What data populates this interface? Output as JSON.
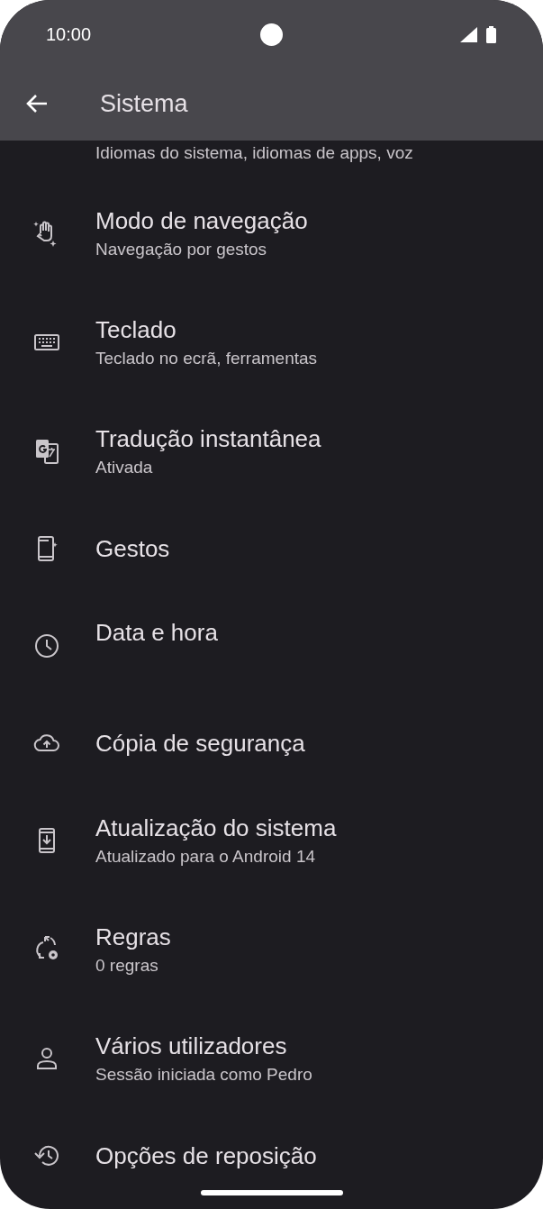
{
  "status_bar": {
    "time": "10:00"
  },
  "app_bar": {
    "title": "Sistema"
  },
  "cut_summary": "Idiomas do sistema, idiomas de apps, voz",
  "items": [
    {
      "kind": "summary",
      "title": "Modo de navegação",
      "summary": "Navegação por gestos"
    },
    {
      "kind": "summary",
      "title": "Teclado",
      "summary": "Teclado no ecrã, ferramentas"
    },
    {
      "kind": "summary",
      "title": "Tradução instantânea",
      "summary": "Ativada"
    },
    {
      "kind": "plain",
      "title": "Gestos"
    },
    {
      "kind": "tall",
      "title": "Data e hora"
    },
    {
      "kind": "plain",
      "title": "Cópia de segurança"
    },
    {
      "kind": "summary",
      "title": "Atualização do sistema",
      "summary": "Atualizado para o Android 14"
    },
    {
      "kind": "summary",
      "title": "Regras",
      "summary": "0 regras"
    },
    {
      "kind": "summary",
      "title": "Vários utilizadores",
      "summary": "Sessão iniciada como Pedro"
    },
    {
      "kind": "plain",
      "title": "Opções de reposição"
    }
  ]
}
